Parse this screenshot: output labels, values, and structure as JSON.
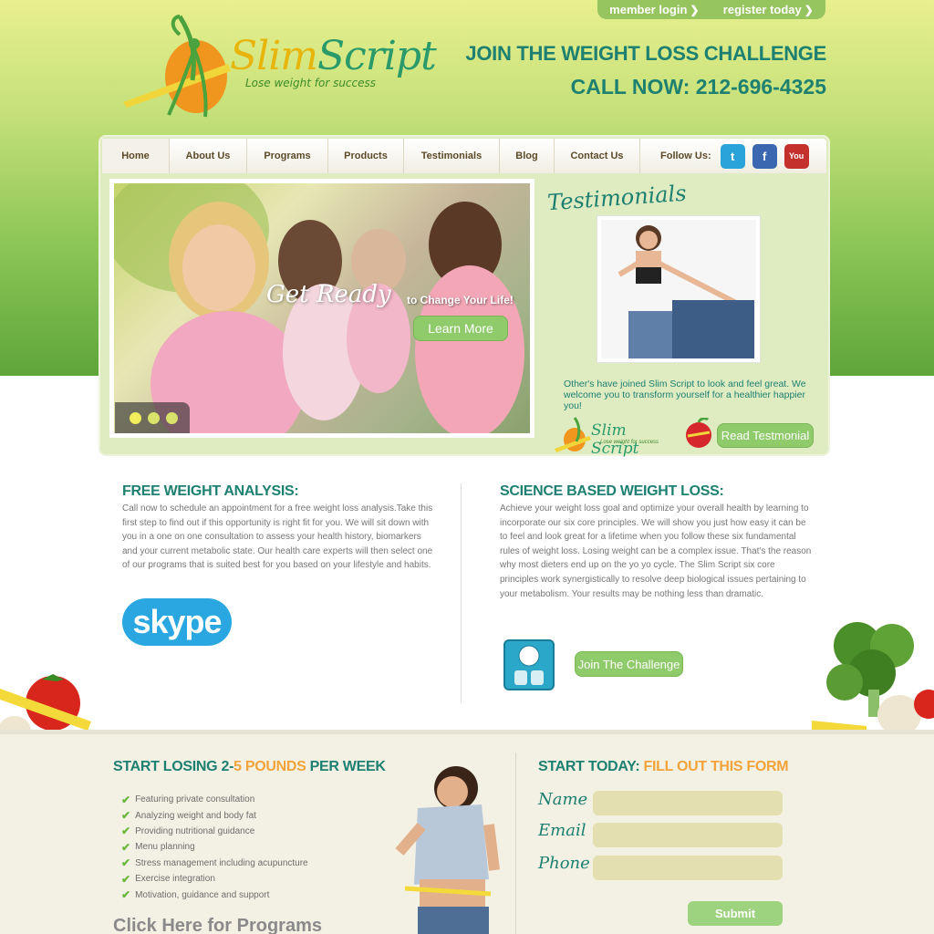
{
  "header": {
    "member_login": "member login",
    "register_today": "register today",
    "logo_name_part1": "Slim",
    "logo_name_part2": "Script",
    "logo_tagline": "Lose weight for success",
    "cta_line1": "JOIN THE WEIGHT LOSS CHALLENGE",
    "cta_line2": "CALL NOW: 212-696-4325"
  },
  "nav": {
    "items": [
      "Home",
      "About Us",
      "Programs",
      "Products",
      "Testimonials",
      "Blog",
      "Contact Us"
    ],
    "follow_label": "Follow Us:",
    "social": [
      "twitter-icon",
      "facebook-icon",
      "youtube-icon"
    ]
  },
  "slider": {
    "headline": "Get Ready",
    "subline": "to Change Your Life!",
    "button": "Learn More"
  },
  "testimonials": {
    "title": "Testimonials",
    "text": "Other's have joined Slim Script to look and feel great. We welcome you to transform yourself for a healthier happier you!",
    "mini_logo": "Slim Script",
    "mini_logo_tagline": "Lose weight for success",
    "button": "Read Testmonial"
  },
  "free_analysis": {
    "title": "FREE WEIGHT ANALYSIS:",
    "text": "Call now to schedule an appointment for a free weight loss analysis.Take this first step to find out if this opportunity is right fit for you. We will sit down with you in a one on one consultation to assess your health history, biomarkers and your current metabolic state. Our health care experts will then select one of our programs that is suited best for you based on your lifestyle and habits.",
    "skype_label": "skype"
  },
  "science": {
    "title": "SCIENCE BASED WEIGHT LOSS:",
    "text": "Achieve your weight loss goal and optimize your overall health by learning to incorporate our six core principles. We will show you just how easy it can be to feel and look great for a lifetime when you follow these six fundamental rules of weight loss. Losing weight can be a complex issue. That's the reason why most dieters end up on the yo yo cycle. The Slim Script six core principles work synergistically to resolve deep biological issues pertaining to your metabolism. Your results may be nothing less than dramatic.",
    "button": "Join The Challenge"
  },
  "losing": {
    "title_part1": "START LOSING 2-",
    "title_part2": "5 POUNDS",
    "title_part3": " PER WEEK",
    "items": [
      "Featuring private consultation",
      "Analyzing weight and body fat",
      "Providing nutritional guidance",
      "Menu planning",
      "Stress management including acupuncture",
      "Exercise integration",
      "Motivation, guidance and support"
    ],
    "click_here": "Click Here for Programs"
  },
  "form": {
    "title_part1": "START TODAY:",
    "title_part2": " FILL OUT THIS FORM",
    "name_label": "Name",
    "email_label": "Email",
    "phone_label": "Phone",
    "submit": "Submit"
  },
  "colors": {
    "teal": "#1d8070",
    "green_button": "#8fcb6a",
    "orange_accent": "#f2a43a",
    "twitter": "#2aa3db",
    "facebook": "#3b66b0",
    "youtube": "#c4302b"
  }
}
